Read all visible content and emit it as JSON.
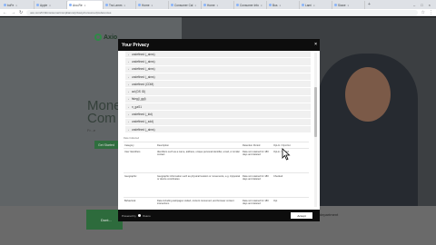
{
  "browser": {
    "tabs": [
      {
        "label": "boFe",
        "active": false
      },
      {
        "label": "Apple",
        "active": false
      },
      {
        "label": "Axo-Re",
        "active": true
      },
      {
        "label": "Tra Lamm",
        "active": false
      },
      {
        "label": "Home",
        "active": false
      },
      {
        "label": "Consumer Cal",
        "active": false
      },
      {
        "label": "Home",
        "active": false
      },
      {
        "label": "Consumer Info",
        "active": false
      },
      {
        "label": "Bus",
        "active": false
      },
      {
        "label": "Lami",
        "active": false
      },
      {
        "label": "Sicwe",
        "active": false
      }
    ],
    "new_tab": "+",
    "window_controls": [
      "–",
      "□",
      "×"
    ],
    "url": "axo.com/hr/ttt/consumer/compliance/privacy/consumer/preferences"
  },
  "site": {
    "brand": "Axio",
    "hero_title_line1": "Mone",
    "hero_title_line2": "Com",
    "hero_sub": "Fr...e",
    "hero_cta": "Get Started",
    "feature_card": "Dont...",
    "feature_right": "department"
  },
  "modal": {
    "title": "Your Privacy",
    "close": "×",
    "vendors": [
      "undefined (_aims)",
      "undefined (_aims)",
      "undefined (_aims)",
      "undefined (_aims)",
      "undefined (CDM)",
      "ad (DS ID)",
      "fsleg(l_ggl)",
      "n_gaS1",
      "undefined (_kid)",
      "undefined (_sdd)",
      "undefined (_aims)"
    ],
    "table": {
      "caption": "Data Collected",
      "headers": [
        "Category",
        "Description",
        "Retention Period",
        "Opt-In / Opt-Out"
      ],
      "rows": [
        [
          "User Identifiers",
          "Identifiers such as a name, address, unique personal identifier, email, or similar contact",
          "Data not retained for 180 days and deleted",
          "Opt-in / Collect"
        ],
        [
          "Geographic",
          "Geographic information such as physical location or movements, e.g. zip/postal or device coordinates",
          "Data not retained for 180 days and deleted",
          "Checked"
        ],
        [
          "Behavioral",
          "Data including webpages visited, content consumed, and browser content interactions",
          "Data not retained for 180 days and deleted",
          "Opt"
        ]
      ]
    },
    "footer_powered": "Powered by",
    "footer_brand": "Osano",
    "accept_label": "Accept"
  }
}
